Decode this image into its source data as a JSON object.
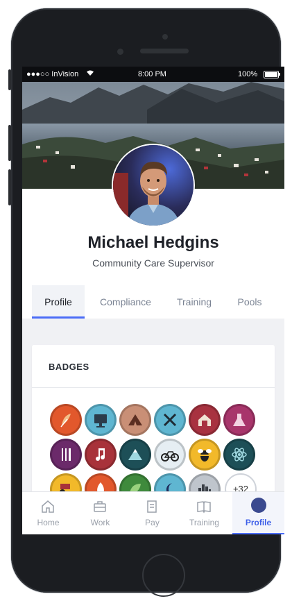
{
  "status_bar": {
    "carrier": "●●●○○ InVision",
    "time": "8:00 PM",
    "battery": "100%"
  },
  "profile": {
    "name": "Michael Hedgins",
    "role": "Community Care Supervisor"
  },
  "tabs": [
    {
      "label": "Profile",
      "active": true
    },
    {
      "label": "Compliance",
      "active": false
    },
    {
      "label": "Training",
      "active": false
    },
    {
      "label": "Pools",
      "active": false
    }
  ],
  "badges_card": {
    "title": "BADGES",
    "more_count": "+32",
    "badges": [
      {
        "icon": "feather-icon",
        "color": "#e2582c"
      },
      {
        "icon": "monitor-icon",
        "color": "#5fb6d1"
      },
      {
        "icon": "tent-icon",
        "color": "#c98f76"
      },
      {
        "icon": "tools-icon",
        "color": "#5fb6d1"
      },
      {
        "icon": "barn-icon",
        "color": "#a83240"
      },
      {
        "icon": "flask-icon",
        "color": "#a8356b"
      },
      {
        "icon": "utensils-icon",
        "color": "#6b2a6a"
      },
      {
        "icon": "music-icon",
        "color": "#a8323a"
      },
      {
        "icon": "mountain-icon",
        "color": "#1d4f57"
      },
      {
        "icon": "bicycle-icon",
        "color": "#e6eef3"
      },
      {
        "icon": "bee-icon",
        "color": "#f2b92a"
      },
      {
        "icon": "atom-icon",
        "color": "#1d4f57"
      },
      {
        "icon": "tractor-icon",
        "color": "#f2b92a"
      },
      {
        "icon": "fire-icon",
        "color": "#e2582c"
      },
      {
        "icon": "leaf-icon",
        "color": "#3f8a3c"
      },
      {
        "icon": "moon-icon",
        "color": "#5fb6d1"
      },
      {
        "icon": "city-icon",
        "color": "#bfc5cc"
      }
    ]
  },
  "bottom_nav": [
    {
      "label": "Home",
      "icon": "home-icon",
      "active": false
    },
    {
      "label": "Work",
      "icon": "briefcase-icon",
      "active": false
    },
    {
      "label": "Pay",
      "icon": "receipt-icon",
      "active": false
    },
    {
      "label": "Training",
      "icon": "book-icon",
      "active": false
    },
    {
      "label": "Profile",
      "icon": "avatar-icon",
      "active": true
    }
  ],
  "colors": {
    "accent": "#4a6cf7",
    "background": "#f0f1f4"
  }
}
